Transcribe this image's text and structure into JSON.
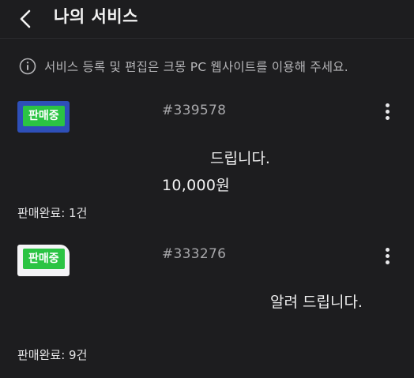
{
  "header": {
    "title": "나의 서비스",
    "back_icon": "chevron-left-icon"
  },
  "notice": {
    "icon": "info-circle-icon",
    "text": "서비스 등록 및 편집은 크몽 PC 웹사이트를 이용해 주세요."
  },
  "services": [
    {
      "badge": "판매중",
      "id": "#339578",
      "title": "드립니다.",
      "price": "10,000원",
      "sold": "판매완료: 1건",
      "thumb_color": "#2e4fb8"
    },
    {
      "badge": "판매중",
      "id": "#333276",
      "title": "알려 드립니다.",
      "sold": "판매완료: 9건",
      "thumb_color": "#f4f4f6"
    }
  ],
  "colors": {
    "background": "#1d1d1f",
    "badge_green": "#2bc443",
    "text_primary": "#f0f0f0",
    "text_secondary": "#a7a7aa"
  }
}
